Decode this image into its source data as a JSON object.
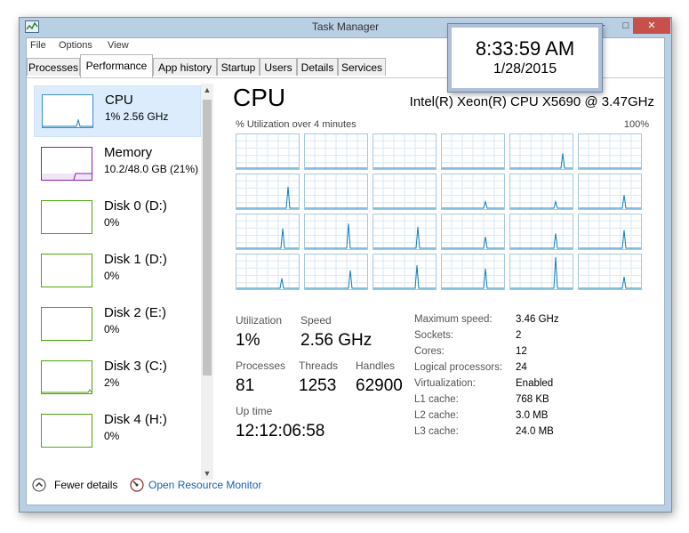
{
  "window": {
    "title": "Task Manager"
  },
  "menu": [
    "File",
    "Options",
    "View"
  ],
  "tabs": [
    "Processes",
    "Performance",
    "App history",
    "Startup",
    "Users",
    "Details",
    "Services"
  ],
  "active_tab": "Performance",
  "sidebar": {
    "items": [
      {
        "name": "CPU",
        "sub": "1% 2.56 GHz",
        "color": "#3c8fcd"
      },
      {
        "name": "Memory",
        "sub": "10.2/48.0 GB (21%)",
        "color": "#8b1fa9"
      },
      {
        "name": "Disk 0 (D:)",
        "sub": "0%",
        "color": "#4da60c"
      },
      {
        "name": "Disk 1 (D:)",
        "sub": "0%",
        "color": "#4da60c"
      },
      {
        "name": "Disk 2 (E:)",
        "sub": "0%",
        "color": "#4da60c"
      },
      {
        "name": "Disk 3 (C:)",
        "sub": "2%",
        "color": "#4da60c"
      },
      {
        "name": "Disk 4 (H:)",
        "sub": "0%",
        "color": "#4da60c"
      }
    ]
  },
  "main": {
    "title": "CPU",
    "model": "Intel(R) Xeon(R) CPU X5690 @ 3.47GHz",
    "graph_label": "% Utilization over 4 minutes",
    "graph_max": "100%",
    "logical_processor_count": 24,
    "stats": {
      "utilization_label": "Utilization",
      "utilization": "1%",
      "speed_label": "Speed",
      "speed": "2.56 GHz",
      "processes_label": "Processes",
      "processes": "81",
      "threads_label": "Threads",
      "threads": "1253",
      "handles_label": "Handles",
      "handles": "62900",
      "uptime_label": "Up time",
      "uptime": "12:12:06:58"
    },
    "specs": [
      {
        "label": "Maximum speed:",
        "value": "3.46 GHz"
      },
      {
        "label": "Sockets:",
        "value": "2"
      },
      {
        "label": "Cores:",
        "value": "12"
      },
      {
        "label": "Logical processors:",
        "value": "24"
      },
      {
        "label": "Virtualization:",
        "value": "Enabled"
      },
      {
        "label": "L1 cache:",
        "value": "768 KB"
      },
      {
        "label": "L2 cache:",
        "value": "3.0 MB"
      },
      {
        "label": "L3 cache:",
        "value": "24.0 MB"
      }
    ]
  },
  "footer": {
    "fewer_details": "Fewer details",
    "resource_monitor": "Open Resource Monitor"
  },
  "clock": {
    "time": "8:33:59 AM",
    "date": "1/28/2015"
  },
  "colors": {
    "cpu_line": "#117dbb",
    "cpu_grid": "#d9eaf4",
    "cpu_border": "#a6c8e0",
    "window_frame": "#b9cfe3"
  }
}
